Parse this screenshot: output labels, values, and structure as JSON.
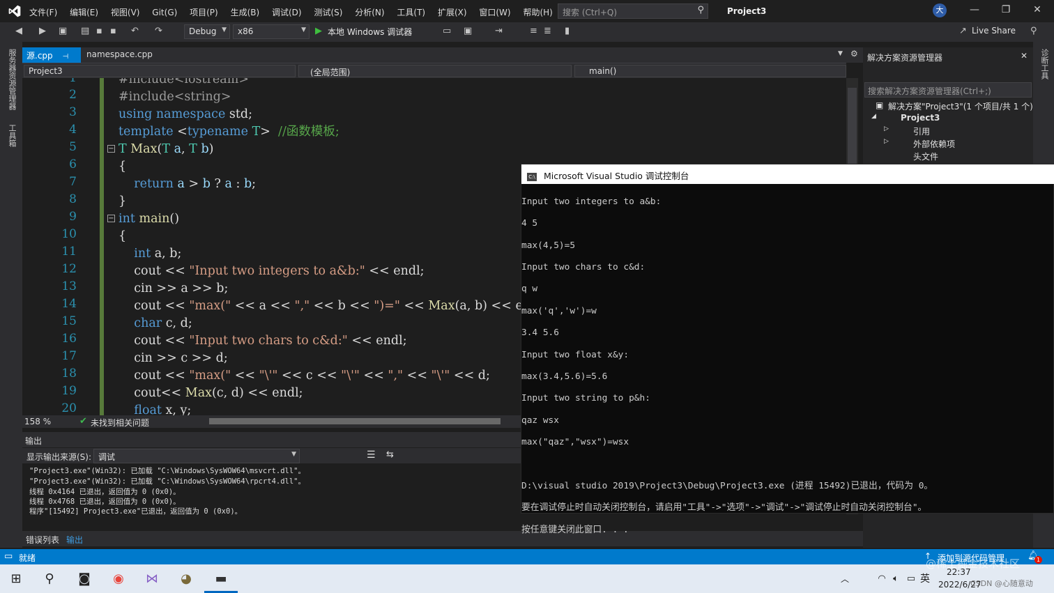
{
  "window": {
    "menu": [
      "文件(F)",
      "编辑(E)",
      "视图(V)",
      "Git(G)",
      "项目(P)",
      "生成(B)",
      "调试(D)",
      "测试(S)",
      "分析(N)",
      "工具(T)",
      "扩展(X)",
      "窗口(W)",
      "帮助(H)"
    ],
    "search_placeholder": "搜索 (Ctrl+Q)",
    "project_name": "Project3",
    "avatar_text": "大"
  },
  "toolbar": {
    "config": "Debug",
    "platform": "x86",
    "run_label": "本地 Windows 调试器",
    "live_share": "Live Share"
  },
  "left_strip": [
    "服务器资源管理器",
    "工具箱"
  ],
  "right_strip": "诊断工具",
  "tabs": [
    {
      "label": "源.cpp"
    },
    {
      "label": "namespace.cpp"
    }
  ],
  "nav": {
    "project": "Project3",
    "scope": "(全局范围)",
    "member": "main()"
  },
  "editor": {
    "line_numbers": [
      "1",
      "2",
      "3",
      "4",
      "5",
      "6",
      "7",
      "8",
      "9",
      "10",
      "11",
      "12",
      "13",
      "14",
      "15",
      "16",
      "17",
      "18",
      "19",
      "20"
    ],
    "zoom": "158 %",
    "issues": "未找到相关问题"
  },
  "output": {
    "title": "输出",
    "source_label": "显示输出来源(S):",
    "source_value": "调试",
    "lines": [
      "\"Project3.exe\"(Win32): 已加载 \"C:\\Windows\\SysWOW64\\msvcrt.dll\"。",
      "\"Project3.exe\"(Win32): 已加载 \"C:\\Windows\\SysWOW64\\rpcrt4.dll\"。",
      "线程 0x4164 已退出，返回值为 0 (0x0)。",
      "线程 0x4768 已退出，返回值为 0 (0x0)。",
      "程序\"[15492] Project3.exe\"已退出，返回值为 0 (0x0)。"
    ]
  },
  "bottom_tabs": [
    "错误列表",
    "输出"
  ],
  "solution": {
    "title": "解决方案资源管理器",
    "search_placeholder": "搜索解决方案资源管理器(Ctrl+;)",
    "items": [
      "解决方案\"Project3\"(1 个项目/共 1 个)",
      "Project3",
      "引用",
      "外部依赖项",
      "头文件"
    ]
  },
  "console": {
    "title": "Microsoft Visual Studio 调试控制台",
    "lines": [
      "Input two integers to a&b:",
      "4 5",
      "max(4,5)=5",
      "Input two chars to c&d:",
      "q w",
      "max('q','w')=w",
      "3.4 5.6",
      "Input two float x&y:",
      "max(3.4,5.6)=5.6",
      "Input two string to p&h:",
      "qaz wsx",
      "max(\"qaz\",\"wsx\")=wsx",
      "",
      "D:\\visual studio 2019\\Project3\\Debug\\Project3.exe (进程 15492)已退出，代码为 0。",
      "要在调试停止时自动关闭控制台，请启用\"工具\"->\"选项\"->\"调试\"->\"调试停止时自动关闭控制台\"。",
      "按任意键关闭此窗口. . ."
    ]
  },
  "status": {
    "ready": "就绪",
    "source_control": "添加到源代码管理",
    "badge": "1"
  },
  "taskbar": {
    "time": "22:37",
    "date": "2022/6/27",
    "ime": "英",
    "watermark": "@稀土掘金技术社区",
    "watermark2": "CSDN @心随意动"
  },
  "colors": {
    "accent": "#007acc",
    "bg": "#1e1e1e",
    "keyword": "#569cd6",
    "string": "#d69d85",
    "comment": "#57a64a"
  }
}
